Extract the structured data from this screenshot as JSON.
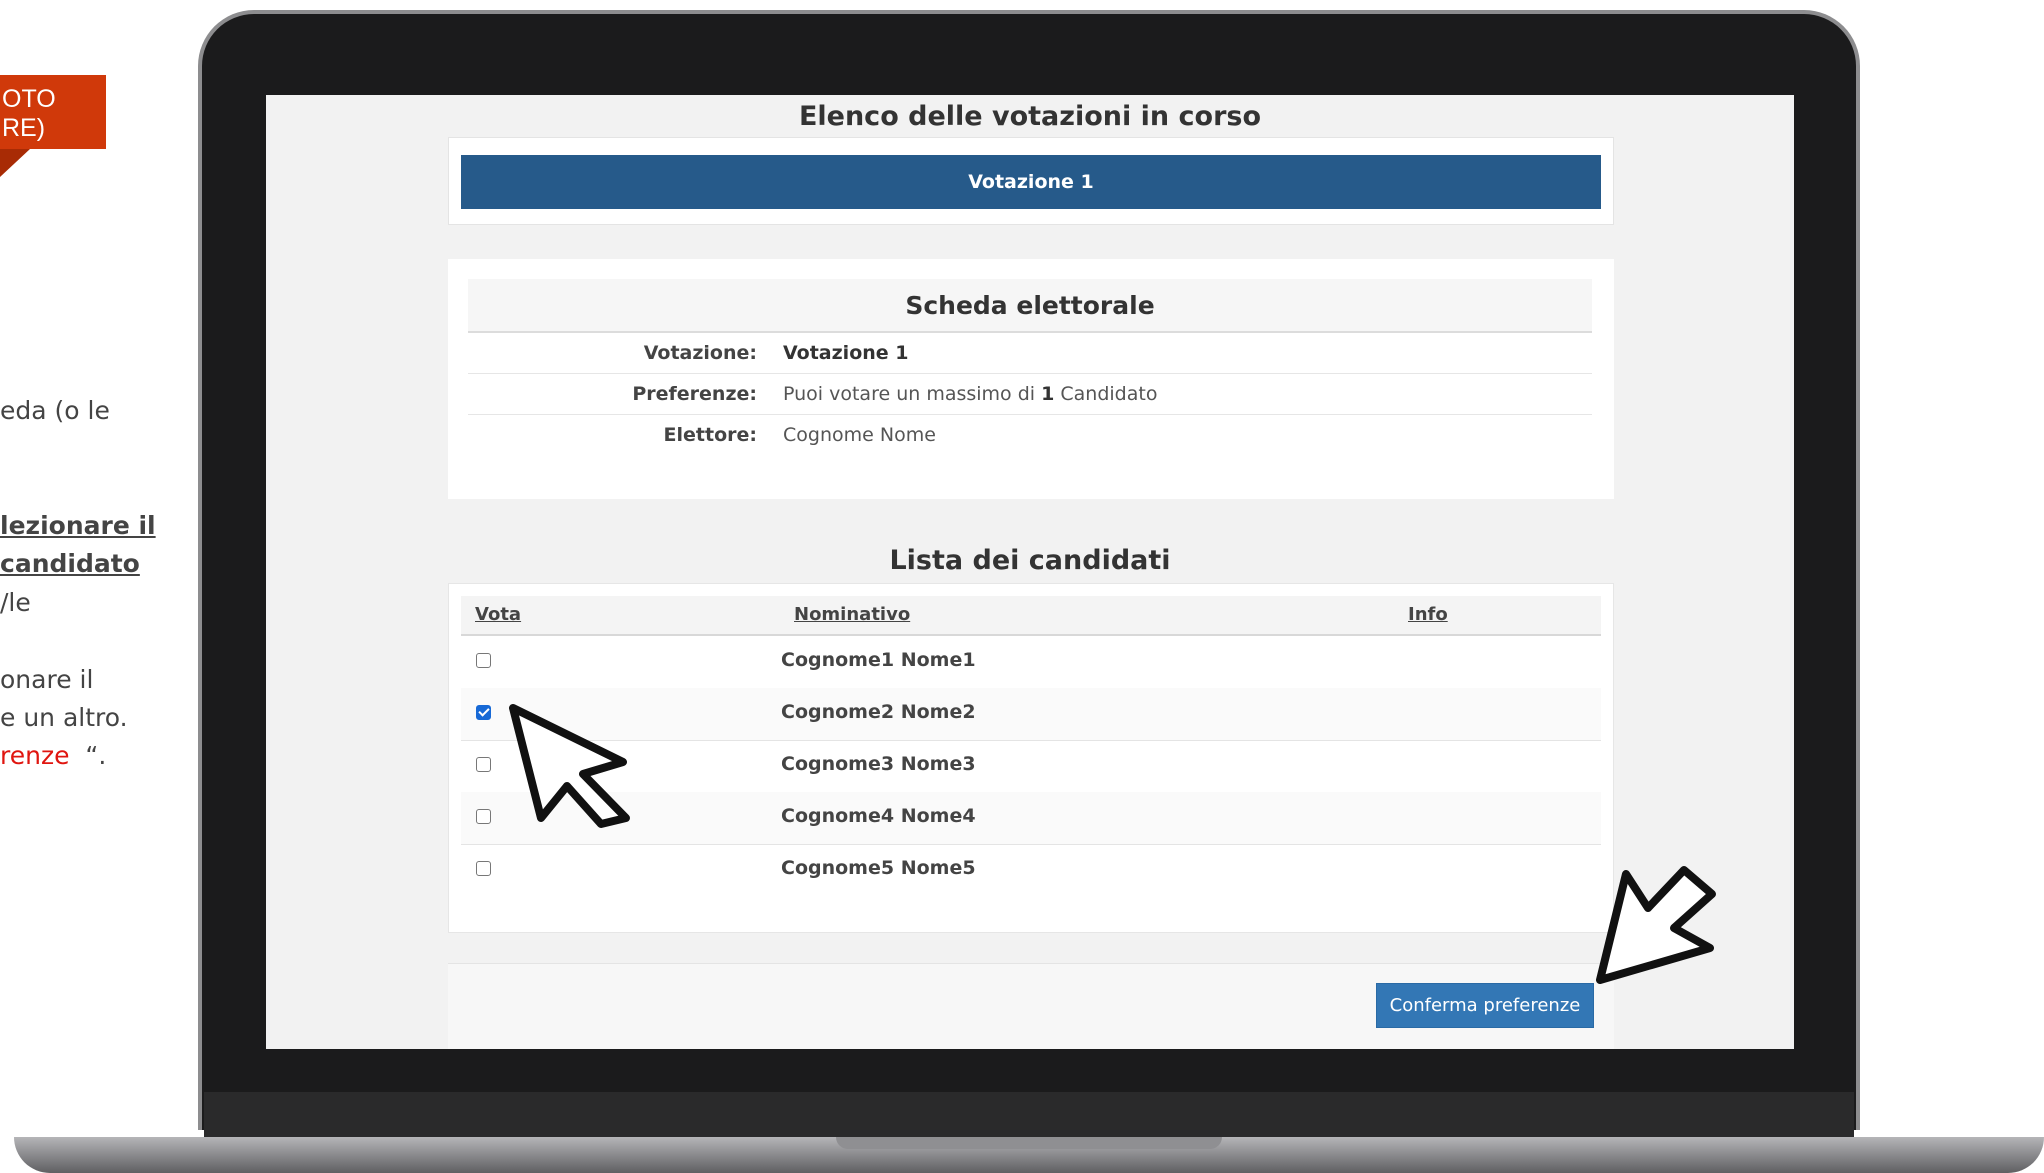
{
  "side": {
    "tag_line1": "OTO",
    "tag_line2": "RE)",
    "line1": "eda (o le",
    "bold1": "lezionare il",
    "bold2": "candidato",
    "line2": "/le",
    "line3": "onare il",
    "line4": "e un altro.",
    "line5_red": "renze",
    "line5_rest": "  “."
  },
  "page": {
    "title": "Elenco delle votazioni in corso",
    "vote_button": "Votazione 1"
  },
  "ballot": {
    "title": "Scheda elettorale",
    "rows": [
      {
        "label": "Votazione:",
        "value": "Votazione 1"
      },
      {
        "label": "Preferenze:",
        "value_prefix": "Puoi votare un massimo di",
        "value_bold": "1",
        "value_suffix": "Candidato"
      },
      {
        "label": "Elettore:",
        "value": "Cognome Nome"
      }
    ]
  },
  "candidates": {
    "title": "Lista dei candidati",
    "columns": [
      "Vota",
      "Nominativo",
      "Info"
    ],
    "rows": [
      {
        "name": "Cognome1 Nome1",
        "checked": false
      },
      {
        "name": "Cognome2 Nome2",
        "checked": true
      },
      {
        "name": "Cognome3 Nome3",
        "checked": false
      },
      {
        "name": "Cognome4 Nome4",
        "checked": false
      },
      {
        "name": "Cognome5 Nome5",
        "checked": false
      }
    ]
  },
  "footer": {
    "confirm_label": "Conferma preferenze"
  },
  "colors": {
    "accent_red": "#d0390a",
    "vote_bar": "#265a8a",
    "confirm_button": "#3377b5"
  },
  "icons": [
    "arrow-cursor-icon",
    "arrow-cursor-icon"
  ]
}
